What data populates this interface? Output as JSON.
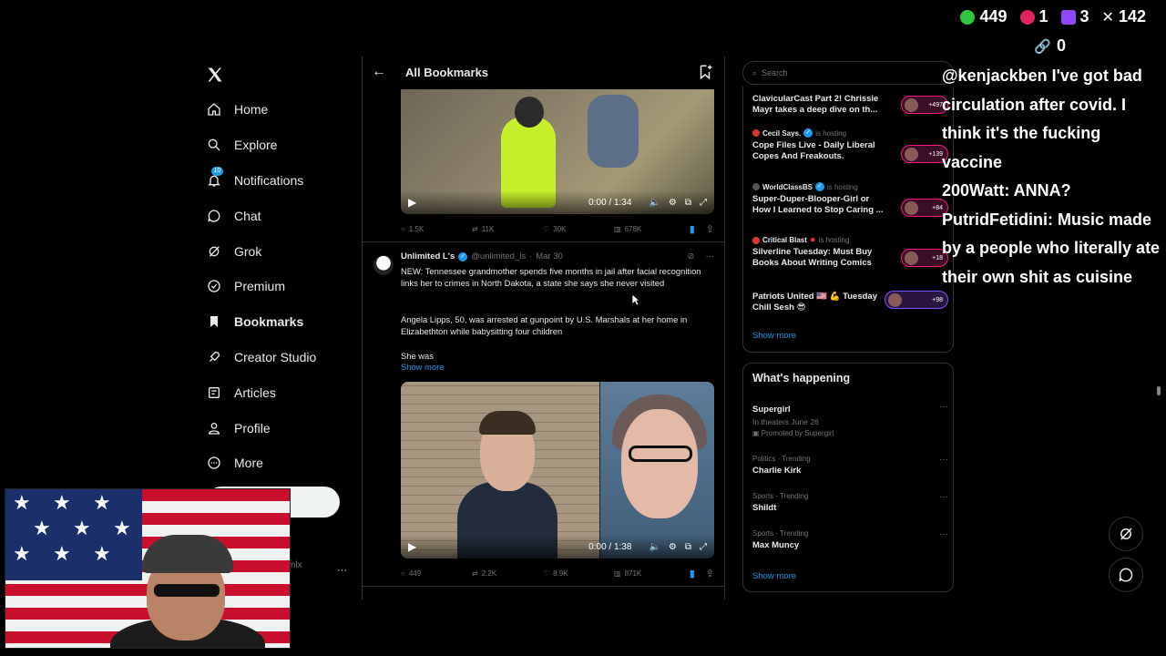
{
  "nav": {
    "items": [
      {
        "label": "Home",
        "icon": "home-icon",
        "active": false
      },
      {
        "label": "Explore",
        "icon": "search-icon",
        "active": false
      },
      {
        "label": "Notifications",
        "icon": "bell-icon",
        "active": false,
        "badge": "10"
      },
      {
        "label": "Chat",
        "icon": "chat-icon",
        "active": false
      },
      {
        "label": "Grok",
        "icon": "grok-icon",
        "active": false
      },
      {
        "label": "Premium",
        "icon": "premium-icon",
        "active": false
      },
      {
        "label": "Bookmarks",
        "icon": "bookmark-icon",
        "active": true
      },
      {
        "label": "Creator Studio",
        "icon": "rocket-icon",
        "active": false
      },
      {
        "label": "Articles",
        "icon": "article-icon",
        "active": false
      },
      {
        "label": "Profile",
        "icon": "person-icon",
        "active": false
      },
      {
        "label": "More",
        "icon": "more-icon",
        "active": false
      }
    ],
    "account_handle_fragment": "mlx"
  },
  "bookmarks": {
    "title": "All Bookmarks",
    "video1": {
      "time": "0:00 / 1:34"
    },
    "actions1": {
      "replies": "1.5K",
      "reposts": "11K",
      "likes": "30K",
      "views": "678K"
    },
    "tweet": {
      "name": "Unlimited L's",
      "handle": "@unlimited_ls",
      "date": "Mar 30",
      "text1": "NEW: Tennessee grandmother spends five months in jail after facial recognition links her to crimes in North Dakota, a state she says she never visited",
      "text2": "Angela Lipps, 50, was arrested at gunpoint by U.S. Marshals at her home in Elizabethton while babysitting four children",
      "text3": "She was",
      "show_more": "Show more"
    },
    "video2": {
      "time": "0:00 / 1:38"
    },
    "actions2": {
      "replies": "449",
      "reposts": "2.2K",
      "likes": "8.9K",
      "views": "871K"
    }
  },
  "sidebar": {
    "search_placeholder": "Search",
    "spaces": [
      {
        "host": "",
        "hosting": "",
        "title": "ClavicularCast Part 2! Chrissie Mayr takes a deep dive on th...",
        "count": "+497"
      },
      {
        "host": "Cecil Says.",
        "hosting": "is hosting",
        "title": "Cope Files Live - Daily Liberal Copes And Freakouts.",
        "count": "+139"
      },
      {
        "host": "WorldClassBS",
        "hosting": "is hosting",
        "title": "Super-Duper-Blooper-Girl or How I Learned to Stop Caring ...",
        "count": "+84"
      },
      {
        "host": "Critical Blast",
        "hosting": "is hosting",
        "title": "Silverline Tuesday: Must Buy Books About Writing Comics",
        "count": "+18"
      },
      {
        "host": "",
        "hosting": "",
        "title": "Patriots United 🇺🇸 💪 Tuesday Chill Sesh 😎",
        "count": "+98"
      }
    ],
    "spaces_show_more": "Show more",
    "trends_title": "What's happening",
    "trends": [
      {
        "meta": "",
        "name": "Supergirl",
        "sub": "In theaters June 26",
        "promo": "Promoted by Supergirl"
      },
      {
        "meta": "Politics · Trending",
        "name": "Charlie Kirk",
        "sub": "",
        "promo": ""
      },
      {
        "meta": "Sports · Trending",
        "name": "Shildt",
        "sub": "",
        "promo": ""
      },
      {
        "meta": "Sports · Trending",
        "name": "Max Muncy",
        "sub": "",
        "promo": ""
      }
    ],
    "trends_show_more": "Show more"
  },
  "stream": {
    "stats": [
      {
        "icon": "rumble-icon",
        "value": "449",
        "color": "#2ec73d"
      },
      {
        "icon": "kick-icon",
        "value": "1",
        "color": "#e0245e"
      },
      {
        "icon": "twitch-icon",
        "value": "3",
        "color": "#9146ff"
      },
      {
        "icon": "x-icon",
        "value": "142",
        "color": "#ffffff"
      }
    ],
    "link_count": "0",
    "chat": [
      "@kenjackben I've got bad circulation after covid. I think it's the fucking vaccine",
      "200Watt: ANNA?",
      "PutridFetidini: Music made by a people who literally ate their own shit as cuisine"
    ]
  },
  "colors": {
    "accent": "#1d9bf0",
    "background": "#000000",
    "border": "#2f3336",
    "spaces_pill": "#f91880"
  }
}
